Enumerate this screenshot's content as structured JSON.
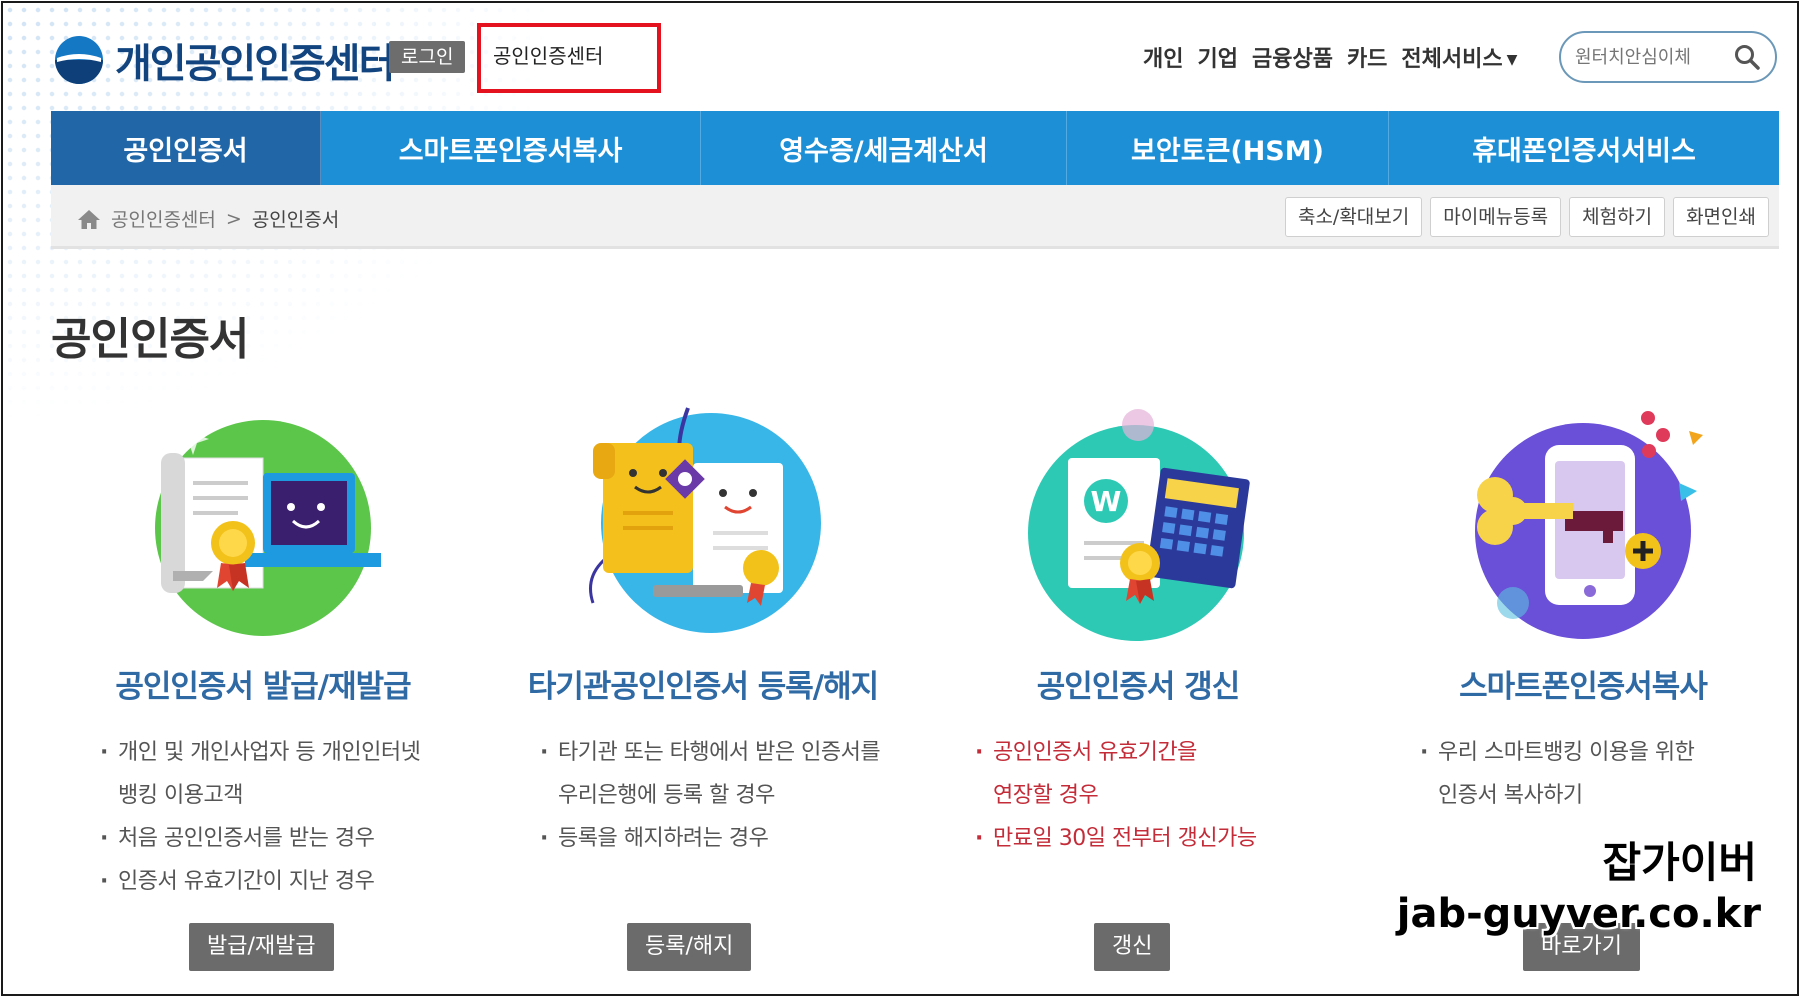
{
  "header": {
    "logo_text": "개인공인인증센터",
    "login_label": "로그인",
    "center_link": "공인인증센터",
    "top_nav": [
      "개인",
      "기업",
      "금융상품",
      "카드",
      "전체서비스"
    ],
    "search_placeholder": "원터치안심이체"
  },
  "main_nav": {
    "tabs": [
      "공인인증서",
      "스마트폰인증서복사",
      "영수증/세금계산서",
      "보안토큰(HSM)",
      "휴대폰인증서서비스"
    ],
    "active": "공인인증서"
  },
  "breadcrumb": {
    "items": [
      "공인인증센터",
      "공인인증서"
    ],
    "separator": ">",
    "tools": [
      "축소/확대보기",
      "마이메뉴등록",
      "체험하기",
      "화면인쇄"
    ]
  },
  "page_title": "공인인증서",
  "cards": [
    {
      "title": "공인인증서 발급/재발급",
      "bullets": [
        "개인 및 개인사업자 등 개인인터넷",
        "뱅킹 이용고객",
        "처음 공인인증서를 받는 경우",
        "인증서 유효기간이 지난 경우"
      ],
      "button": "발급/재발급"
    },
    {
      "title": "타기관공인인증서 등록/해지",
      "bullets": [
        "타기관 또는 타행에서 받은 인증서를",
        "우리은행에 등록 할 경우",
        "등록을 해지하려는 경우"
      ],
      "button": "등록/해지"
    },
    {
      "title": "공인인증서 갱신",
      "bullets": [
        "공인인증서 유효기간을",
        "연장할 경우",
        "만료일 30일 전부터 갱신가능"
      ],
      "button": "갱신"
    },
    {
      "title": "스마트폰인증서복사",
      "bullets": [
        "우리 스마트뱅킹 이용을 위한",
        "인증서 복사하기"
      ],
      "button": "바로가기"
    }
  ],
  "watermark": {
    "name": "잡가이버",
    "url": "jab-guyver.co.kr"
  },
  "colors": {
    "brand": "#12457f",
    "nav": "#1c8fd6",
    "nav_active": "#2167a8",
    "card_title": "#2f6aa5",
    "alert_red": "#c32c38",
    "highlight": "#e3121e"
  },
  "icons": [
    "logo-icon",
    "search-icon",
    "home-icon",
    "caret-down-icon"
  ]
}
